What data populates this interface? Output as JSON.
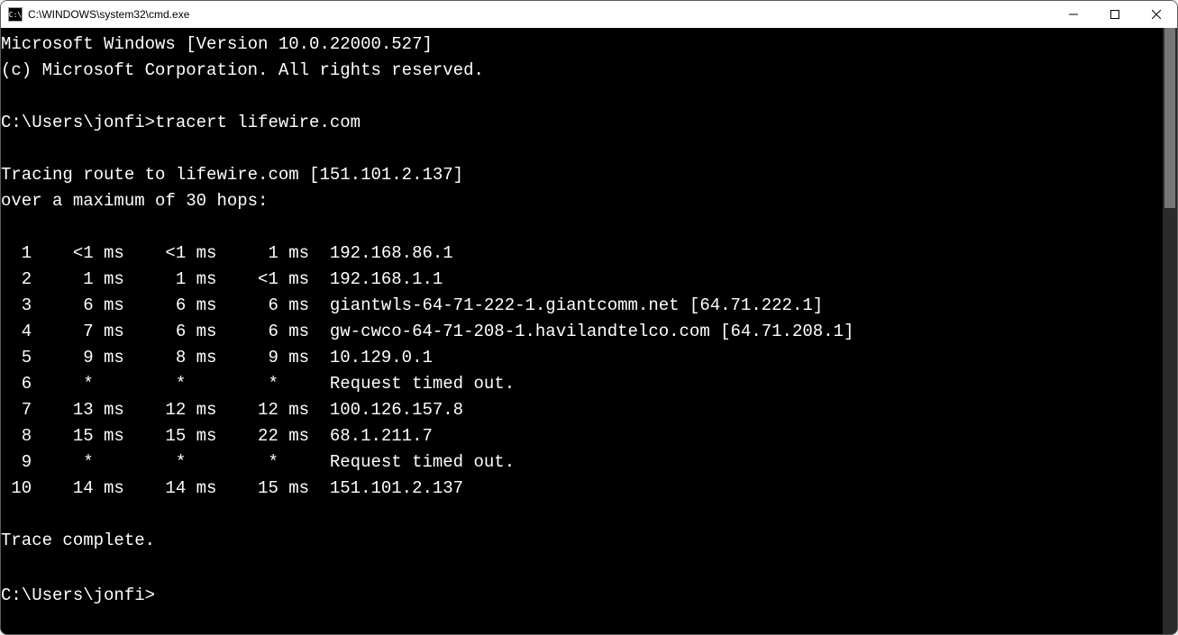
{
  "window": {
    "icon_text": "C:\\",
    "title": "C:\\WINDOWS\\system32\\cmd.exe"
  },
  "terminal": {
    "line_version": "Microsoft Windows [Version 10.0.22000.527]",
    "line_copyright": "(c) Microsoft Corporation. All rights reserved.",
    "prompt1_path": "C:\\Users\\jonfi>",
    "prompt1_cmd": "tracert lifewire.com",
    "tracing_line1": "Tracing route to lifewire.com [151.101.2.137]",
    "tracing_line2": "over a maximum of 30 hops:",
    "hops": [
      {
        "n": 1,
        "t1": "<1 ms",
        "t2": "<1 ms",
        "t3": "1 ms",
        "host": "192.168.86.1"
      },
      {
        "n": 2,
        "t1": "1 ms",
        "t2": "1 ms",
        "t3": "<1 ms",
        "host": "192.168.1.1"
      },
      {
        "n": 3,
        "t1": "6 ms",
        "t2": "6 ms",
        "t3": "6 ms",
        "host": "giantwls-64-71-222-1.giantcomm.net [64.71.222.1]"
      },
      {
        "n": 4,
        "t1": "7 ms",
        "t2": "6 ms",
        "t3": "6 ms",
        "host": "gw-cwco-64-71-208-1.havilandtelco.com [64.71.208.1]"
      },
      {
        "n": 5,
        "t1": "9 ms",
        "t2": "8 ms",
        "t3": "9 ms",
        "host": "10.129.0.1"
      },
      {
        "n": 6,
        "t1": "*",
        "t2": "*",
        "t3": "*",
        "host": "Request timed out."
      },
      {
        "n": 7,
        "t1": "13 ms",
        "t2": "12 ms",
        "t3": "12 ms",
        "host": "100.126.157.8"
      },
      {
        "n": 8,
        "t1": "15 ms",
        "t2": "15 ms",
        "t3": "22 ms",
        "host": "68.1.211.7"
      },
      {
        "n": 9,
        "t1": "*",
        "t2": "*",
        "t3": "*",
        "host": "Request timed out."
      },
      {
        "n": 10,
        "t1": "14 ms",
        "t2": "14 ms",
        "t3": "15 ms",
        "host": "151.101.2.137"
      }
    ],
    "trace_complete": "Trace complete.",
    "prompt2_path": "C:\\Users\\jonfi>"
  }
}
